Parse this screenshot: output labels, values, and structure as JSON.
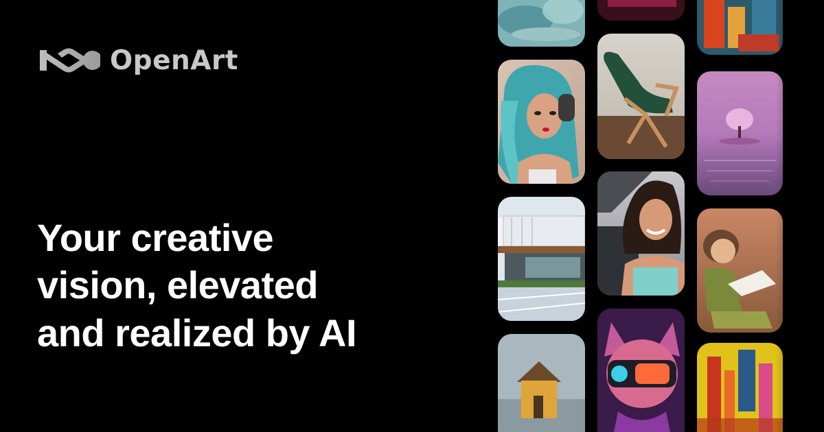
{
  "brand": {
    "name": "OpenArt",
    "logo_icon": "infinity-loop-icon",
    "text_color": "#c8c8c8"
  },
  "hero": {
    "headline_lines": [
      "Your creative",
      "vision, elevated",
      "and realized by AI"
    ],
    "text_color": "#ffffff"
  },
  "gallery": {
    "tiles": [
      {
        "name": "teal-abstract-art",
        "column": 1
      },
      {
        "name": "anime-girl-headphones",
        "column": 1
      },
      {
        "name": "modern-house-architecture",
        "column": 1
      },
      {
        "name": "yellow-house-by-sea",
        "column": 1
      },
      {
        "name": "magenta-abstract-art",
        "column": 2
      },
      {
        "name": "green-lounge-chair",
        "column": 2
      },
      {
        "name": "smiling-woman-portrait",
        "column": 2
      },
      {
        "name": "neon-cat-goggles",
        "column": 2
      },
      {
        "name": "colorful-paint-strokes",
        "column": 3
      },
      {
        "name": "pink-tree-on-lake",
        "column": 3
      },
      {
        "name": "boy-reading-book",
        "column": 3
      },
      {
        "name": "vibrant-abstract-painting",
        "column": 3
      }
    ]
  },
  "colors": {
    "background": "#000000"
  }
}
